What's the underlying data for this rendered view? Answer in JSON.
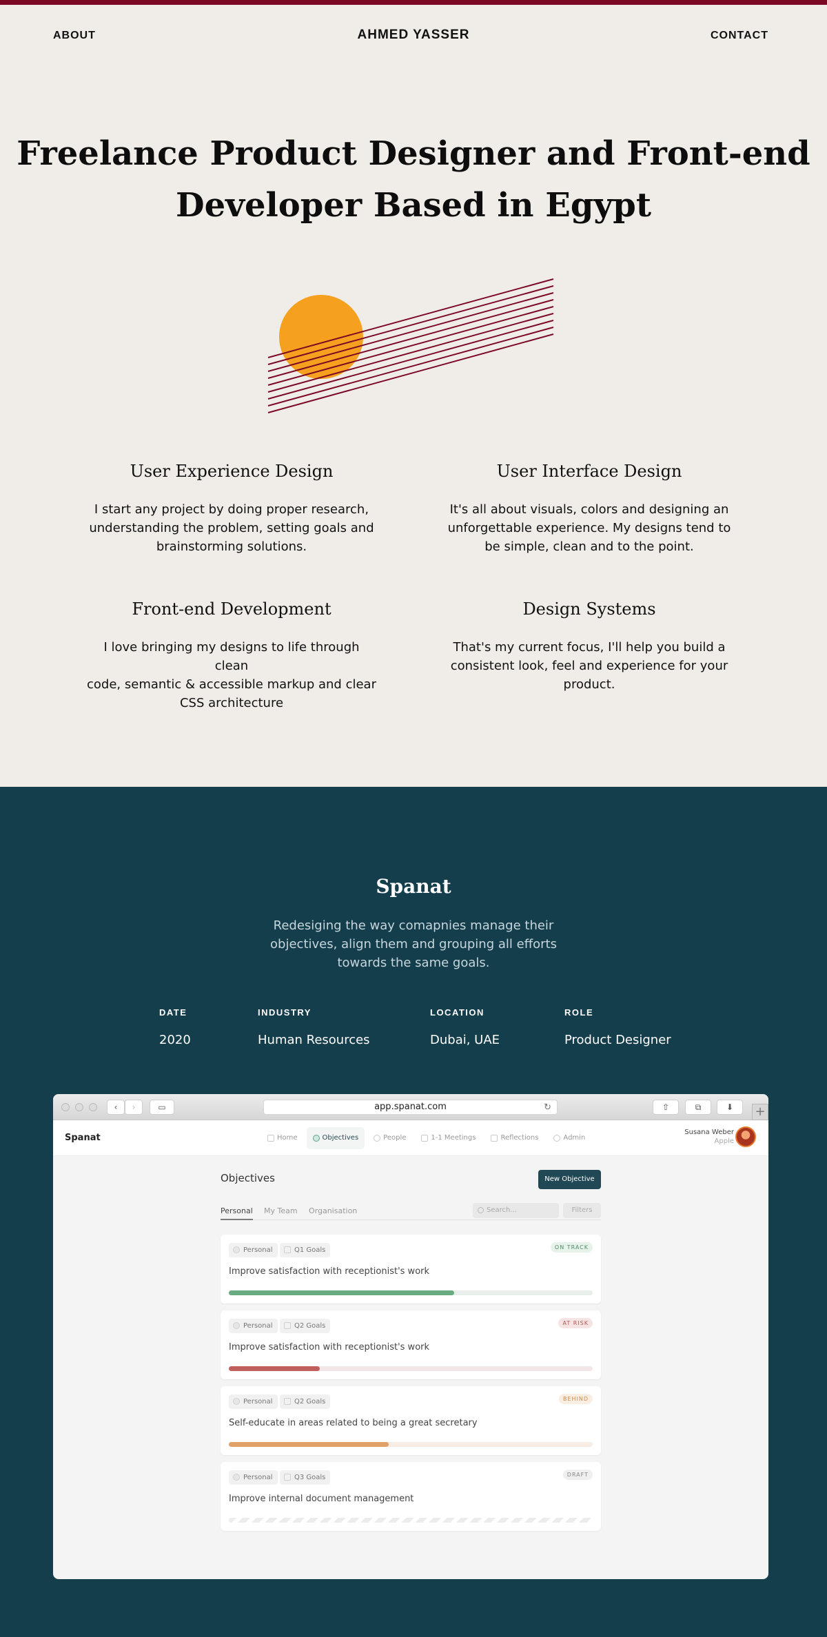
{
  "nav": {
    "about": "ABOUT",
    "brand": "AHMED YASSER",
    "contact": "CONTACT"
  },
  "hero": {
    "line1": "Freelance Product Designer and Front-end",
    "line2": "Developer Based in Egypt"
  },
  "colors": {
    "accent": "#7c0a24",
    "sun": "#f5a01f",
    "dark_bg": "#153e4d",
    "page_bg": "#f0ece8"
  },
  "services": [
    {
      "title": "User Experience Design",
      "lines": [
        "I start any project by doing proper research,",
        "understanding the problem, setting goals and",
        "brainstorming solutions."
      ]
    },
    {
      "title": "User Interface Design",
      "lines": [
        "It's all about visuals, colors and designing an",
        "unforgettable experience. My designs tend to",
        "be simple, clean and to the point."
      ]
    },
    {
      "title": "Front-end Development",
      "lines": [
        "I love bringing my designs to life through clean",
        "code, semantic & accessible markup and clear",
        "CSS architecture"
      ]
    },
    {
      "title": "Design Systems",
      "lines": [
        "That's my current focus, I'll help you build a",
        "consistent look, feel and experience for your",
        "product."
      ]
    }
  ],
  "project": {
    "title": "Spanat",
    "desc_lines": [
      "Redesiging the way comapnies manage their",
      "objectives, align them and grouping all efforts",
      "towards the same goals."
    ],
    "meta": [
      {
        "label": "DATE",
        "value": "2020"
      },
      {
        "label": "INDUSTRY",
        "value": "Human Resources"
      },
      {
        "label": "LOCATION",
        "value": "Dubai, UAE"
      },
      {
        "label": "ROLE",
        "value": "Product Designer"
      }
    ]
  },
  "browser": {
    "url": "app.spanat.com",
    "app_name": "Spanat",
    "nav": [
      "Home",
      "Objectives",
      "People",
      "1-1 Meetings",
      "Reflections",
      "Admin"
    ],
    "active_nav": "Objectives",
    "user": {
      "name": "Susana Weber",
      "company": "Apple"
    },
    "page_title": "Objectives",
    "new_button": "New Objective",
    "tabs": [
      "Personal",
      "My Team",
      "Organisation"
    ],
    "search_placeholder": "Search...",
    "filters": "Filters",
    "objectives": [
      {
        "tag": "Personal",
        "goal": "Q1 Goals",
        "title": "Improve satisfaction with receptionist's work",
        "status": "ON TRACK",
        "progress": 0.62,
        "bar": "#6aaa7f",
        "track": "#e8efea",
        "status_bg": "#e6f2ea",
        "status_fg": "#4f8c63"
      },
      {
        "tag": "Personal",
        "goal": "Q2 Goals",
        "title": "Improve satisfaction with receptionist's work",
        "status": "AT RISK",
        "progress": 0.25,
        "bar": "#c0605c",
        "track": "#f2e6e6",
        "status_bg": "#f6e3e3",
        "status_fg": "#b35653"
      },
      {
        "tag": "Personal",
        "goal": "Q2 Goals",
        "title": "Self-educate in areas related to being a great secretary",
        "status": "BEHIND",
        "progress": 0.44,
        "bar": "#dfa167",
        "track": "#f7ede4",
        "status_bg": "#faeee2",
        "status_fg": "#c78a50"
      },
      {
        "tag": "Personal",
        "goal": "Q3 Goals",
        "title": "Improve internal document management",
        "status": "DRAFT",
        "progress": 0,
        "bar": "#e6e6e6",
        "track": "#ffffff",
        "status_bg": "#efefef",
        "status_fg": "#888888"
      }
    ]
  }
}
